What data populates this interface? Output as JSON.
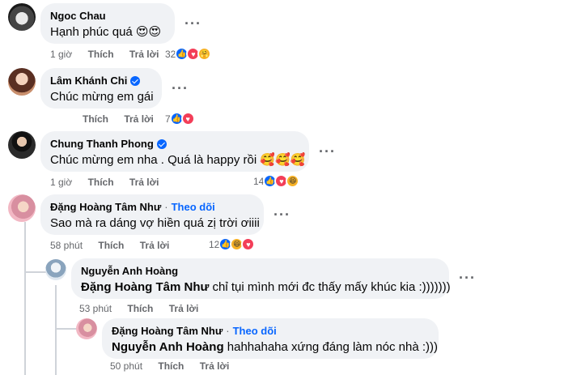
{
  "comments": [
    {
      "name": "Ngoc Chau",
      "text": "Hạnh phúc quá 😍😍",
      "time": "1 giờ",
      "like": "Thích",
      "reply": "Trả lời",
      "reactions": "32"
    },
    {
      "name": "Lâm Khánh Chi",
      "text": "Chúc mừng em gái",
      "time": "",
      "like": "Thích",
      "reply": "Trả lời",
      "reactions": "7"
    },
    {
      "name": "Chung Thanh Phong",
      "text": "Chúc mừng em nha . Quá là happy rồi 🥰🥰🥰",
      "time": "1 giờ",
      "like": "Thích",
      "reply": "Trả lời",
      "reactions": "14"
    },
    {
      "name": "Đặng Hoàng Tâm Như",
      "follow": "Theo dõi",
      "dot": "·",
      "text": "Sao mà ra dáng vợ hiền quá zị trời ơiiii",
      "time": "58 phút",
      "like": "Thích",
      "reply": "Trả lời",
      "reactions": "12"
    },
    {
      "name": "Nguyễn Anh Hoàng",
      "mention": "Đặng Hoàng Tâm Như",
      "text": "chỉ tụi mình mới đc thấy mấy khúc kia :)))))))",
      "time": "53 phút",
      "like": "Thích",
      "reply": "Trả lời"
    },
    {
      "name": "Đặng Hoàng Tâm Như",
      "follow": "Theo dõi",
      "dot": "·",
      "mention": "Nguyễn Anh Hoàng",
      "text": "hahhahaha xứng đáng làm nóc nhà :)))",
      "time": "50 phút",
      "like": "Thích",
      "reply": "Trả lời"
    }
  ],
  "icons": {
    "more": "more-options-icon",
    "like": "like-reaction-icon",
    "love": "love-reaction-icon",
    "care": "care-reaction-icon",
    "haha": "haha-reaction-icon"
  },
  "colors": {
    "bubble": "#f0f2f5",
    "link": "#0866ff",
    "meta": "#65676b",
    "like": "#0866ff",
    "love": "#f33e58"
  }
}
